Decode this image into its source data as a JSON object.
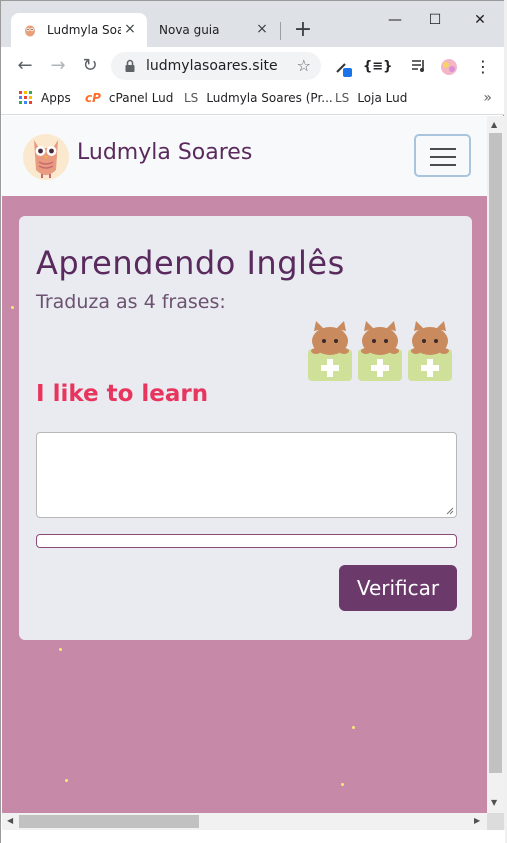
{
  "browser": {
    "tabs": [
      {
        "title": "Ludmyla Soa",
        "close": "×"
      },
      {
        "title": "Nova guia",
        "close": "×"
      }
    ],
    "new_tab": "+",
    "window_controls": {
      "minimize": "—",
      "maximize": "☐",
      "close": "✕"
    },
    "nav": {
      "back": "←",
      "forward": "→",
      "reload": "↻"
    },
    "url": "ludmylasoares.site",
    "bookmark_star": "☆",
    "extensions": {
      "profile_ext": "{≡}",
      "menu": "⋮"
    },
    "bookmarks": [
      {
        "label": "Apps",
        "icon": "apps-grid-icon"
      },
      {
        "label": "cPanel Lud",
        "icon": "cpanel-icon"
      },
      {
        "label": "Ludmyla Soares (Pr...",
        "icon": "ls-icon"
      },
      {
        "label": "Loja Lud",
        "icon": "ls-icon"
      }
    ],
    "bookmarks_more": "»"
  },
  "page": {
    "brand": "Ludmyla Soares",
    "title": "Aprendendo Inglês",
    "subtitle": "Traduza as 4 frases:",
    "phrase": "I like to learn",
    "answer_value": "",
    "progress": 0,
    "verify_label": "Verificar",
    "lives_count": 3
  },
  "colors": {
    "background": "#c68aa8",
    "brand_text": "#5a2a5e",
    "phrase": "#e8355e",
    "button": "#6b3a6b",
    "card": "#e9ebf0"
  }
}
